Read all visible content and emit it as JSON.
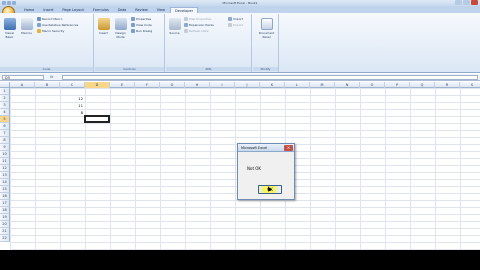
{
  "window": {
    "title": "Microsoft Excel - Book1"
  },
  "ribbon": {
    "tabs": [
      "Home",
      "Insert",
      "Page Layout",
      "Formulas",
      "Data",
      "Review",
      "View",
      "Developer"
    ],
    "active_tab": "Developer",
    "groups": {
      "code": {
        "label": "Code",
        "visual_basic": "Visual Basic",
        "macros": "Macros",
        "record_macro": "Record Macro",
        "relative_refs": "Use Relative References",
        "macro_security": "Macro Security"
      },
      "controls": {
        "label": "Controls",
        "insert": "Insert",
        "design_mode": "Design Mode",
        "properties": "Properties",
        "view_code": "View Code",
        "run_dialog": "Run Dialog"
      },
      "xml": {
        "label": "XML",
        "source": "Source",
        "map_properties": "Map Properties",
        "expansion_packs": "Expansion Packs",
        "refresh_data": "Refresh Data",
        "import": "Import",
        "export": "Export"
      },
      "modify": {
        "label": "Modify",
        "document_panel": "Document Panel"
      }
    }
  },
  "formula_bar": {
    "name_box": "D5",
    "fx_label": "fx",
    "value": ""
  },
  "columns": [
    "A",
    "B",
    "C",
    "D",
    "E",
    "F",
    "G",
    "H",
    "I",
    "J",
    "K",
    "L",
    "M",
    "N",
    "O",
    "P",
    "Q",
    "R",
    "S"
  ],
  "selected_column": "D",
  "rows": [
    "1",
    "2",
    "3",
    "4",
    "5",
    "6",
    "7",
    "8",
    "9",
    "10",
    "11",
    "12",
    "13",
    "14",
    "15",
    "16",
    "17",
    "18",
    "19",
    "20",
    "21",
    "22"
  ],
  "selected_row": "5",
  "cells": {
    "c2": "12",
    "c3": "11",
    "c4": "8"
  },
  "dialog": {
    "title": "Microsoft Excel",
    "close_glyph": "×",
    "message": "Not OK",
    "ok_label": "OK"
  },
  "colors": {
    "ribbon_blue": "#bfd3ec",
    "selection": "#f7d68a",
    "ok_highlight": "#ffff55"
  }
}
